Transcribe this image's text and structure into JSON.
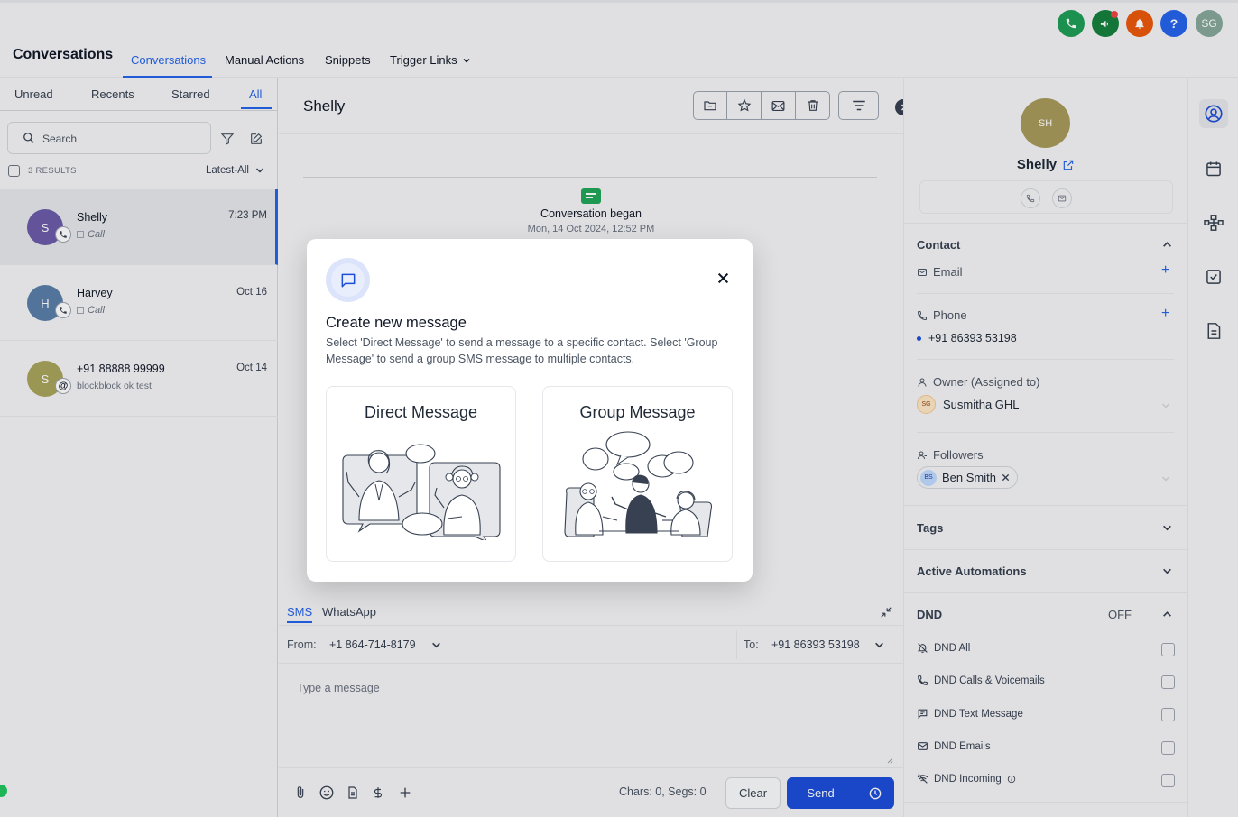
{
  "header": {
    "app_title": "Conversations",
    "tabs": [
      "Conversations",
      "Manual Actions",
      "Snippets",
      "Trigger Links"
    ],
    "user_initials": "SG",
    "colors": {
      "phone": "#1f9d55",
      "megaphone": "#15803d",
      "bell": "#ea580c",
      "help": "#2563eb",
      "avatar": "#86a89a"
    }
  },
  "left": {
    "tabs": [
      "Unread",
      "Recents",
      "Starred",
      "All"
    ],
    "search_placeholder": "Search",
    "results": "3 RESULTS",
    "sort": "Latest-All",
    "conversations": [
      {
        "initial": "S",
        "name": "Shelly",
        "sub": "Call",
        "time": "7:23 PM",
        "color": "#6b5ba8"
      },
      {
        "initial": "H",
        "name": "Harvey",
        "sub": "Call",
        "time": "Oct 16",
        "color": "#5b7ea8"
      },
      {
        "initial": "S",
        "name": "+91 88888 99999",
        "sub": "blockblock ok test",
        "time": "Oct 14",
        "color": "#a8a35b"
      }
    ]
  },
  "center": {
    "contact_name": "Shelly",
    "began_title": "Conversation began",
    "began_date": "Mon, 14 Oct 2024, 12:52 PM"
  },
  "composer": {
    "tabs": [
      "SMS",
      "WhatsApp"
    ],
    "from_label": "From:",
    "from_value": "+1 864-714-8179",
    "to_label": "To:",
    "to_value": "+91 86393 53198",
    "placeholder": "Type a message",
    "chars": "Chars: 0, Segs: 0",
    "clear": "Clear",
    "send": "Send"
  },
  "right": {
    "initials": "SH",
    "name": "Shelly",
    "contact_title": "Contact",
    "email_label": "Email",
    "phone_label": "Phone",
    "phone_value": "+91 86393 53198",
    "owner_label": "Owner (Assigned to)",
    "owner_initials": "SG",
    "owner_name": "Susmitha GHL",
    "followers_label": "Followers",
    "follower_initials": "BS",
    "follower_name": "Ben Smith",
    "tags": "Tags",
    "automations": "Active Automations",
    "dnd": "DND",
    "dnd_state": "OFF",
    "dnd_items": [
      "DND All",
      "DND Calls & Voicemails",
      "DND Text Message",
      "DND Emails",
      "DND Incoming"
    ]
  },
  "modal": {
    "title": "Create new message",
    "description": "Select 'Direct Message' to send a message to a specific contact. Select 'Group Message' to send a group SMS message to multiple contacts.",
    "direct": "Direct Message",
    "group": "Group Message"
  }
}
